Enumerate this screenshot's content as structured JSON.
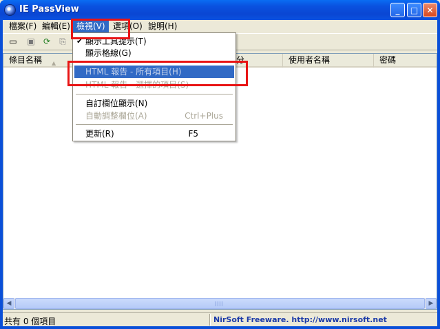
{
  "window": {
    "title": "IE PassView"
  },
  "menubar": [
    {
      "label": "檔案(F)"
    },
    {
      "label": "編輯(E)"
    },
    {
      "label": "檢視(V)"
    },
    {
      "label": "選項(O)"
    },
    {
      "label": "說明(H)"
    }
  ],
  "list": {
    "columns": [
      "條目名稱",
      "",
      "使用者名稱",
      "密碼"
    ],
    "partial_header": "分"
  },
  "dropdown": {
    "items": [
      {
        "label": "顯示工具提示(T)",
        "checked": true
      },
      {
        "label": "顯示格線(G)"
      },
      {
        "label": "HTML 報告 - 所有項目(H)",
        "state": "highlighted-disabled"
      },
      {
        "label": "HTML 報告 - 選擇的項目(S)",
        "state": "disabled"
      },
      {
        "label": "自訂欄位顯示(N)"
      },
      {
        "label": "自動調整欄位(A)",
        "shortcut": "Ctrl+Plus",
        "state": "disabled"
      },
      {
        "label": "更新(R)",
        "shortcut": "F5"
      }
    ]
  },
  "statusbar": {
    "left": "共有 0 個項目",
    "right": "NirSoft Freeware.  http://www.nirsoft.net"
  },
  "icons": [
    "app-icon",
    "minimize-icon",
    "maximize-icon",
    "close-icon",
    "toolbar-html-icon",
    "toolbar-save-icon",
    "toolbar-refresh-icon",
    "toolbar-copy-icon",
    "checkmark-icon"
  ],
  "colors": {
    "highlight": "#316ac5",
    "annotation": "#e81414",
    "titlebar": "#0a52e0"
  }
}
